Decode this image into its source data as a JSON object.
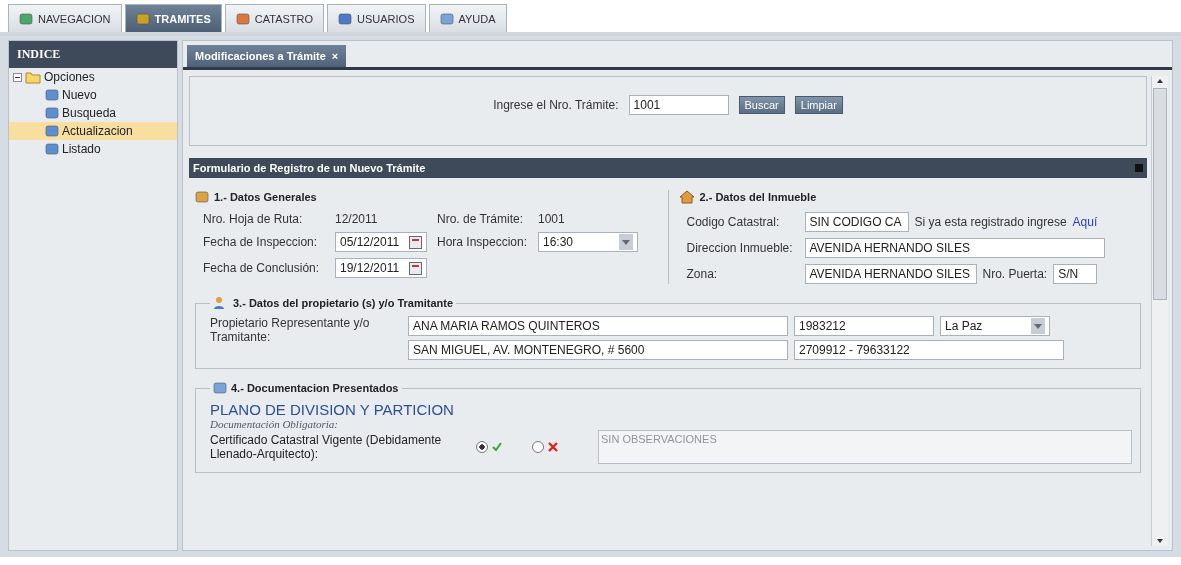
{
  "top_tabs": [
    {
      "label": "NAVEGACION",
      "selected": false
    },
    {
      "label": "TRAMITES",
      "selected": true
    },
    {
      "label": "CATASTRO",
      "selected": false
    },
    {
      "label": "USUARIOS",
      "selected": false
    },
    {
      "label": "AYUDA",
      "selected": false
    }
  ],
  "sidebar": {
    "title": "INDICE",
    "tree": [
      {
        "label": "Opciones",
        "expanded": true,
        "children": [
          {
            "label": "Nuevo",
            "selected": false
          },
          {
            "label": "Busqueda",
            "selected": false
          },
          {
            "label": "Actualizacion",
            "selected": true
          },
          {
            "label": "Listado",
            "selected": false
          }
        ]
      }
    ]
  },
  "doc_tab": {
    "label": "Modificaciones a Trámite",
    "close": "×"
  },
  "search": {
    "label": "Ingrese el Nro. Trámite:",
    "value": "1001",
    "buttons": [
      "Buscar",
      "Limpiar"
    ]
  },
  "form_title": "Formulario de Registro de un Nuevo Trámite",
  "general": {
    "title": "1.- Datos Generales",
    "rows": [
      [
        {
          "kind": "static",
          "label": "Nro. Hoja de Ruta:",
          "value": "12/2011"
        },
        {
          "kind": "static",
          "label": "Nro. de Trámite:",
          "value": "1001"
        }
      ],
      [
        {
          "kind": "date",
          "label": "Fecha de Inspeccion:",
          "value": "05/12/2011"
        },
        {
          "kind": "combo",
          "label": "Hora Inspeccion:",
          "value": "16:30"
        }
      ],
      [
        {
          "kind": "date",
          "label": "Fecha de Conclusión:",
          "value": "19/12/2011"
        }
      ]
    ]
  },
  "inmueble": {
    "title": "2.- Datos del Inmueble",
    "rows": [
      {
        "label": "Codigo Catastral:",
        "value": "SIN CODIGO CA",
        "note": "Si ya esta registrado ingrese",
        "link": "Aquí"
      },
      {
        "label": "Direccion Inmueble:",
        "value": "AVENIDA HERNANDO SILES"
      },
      {
        "label": "Zona:",
        "value": "AVENIDA HERNANDO SILES",
        "extra_label": "Nro. Puerta:",
        "extra_value": "S/N"
      }
    ]
  },
  "propietario": {
    "title": "3.- Datos del propietario (s) y/o Tramitante",
    "label": "Propietario Representante y/o Tramitante:",
    "rows": [
      [
        {
          "kind": "text",
          "value": "ANA MARIA RAMOS QUINTEROS"
        },
        {
          "kind": "text",
          "value": "1983212"
        },
        {
          "kind": "combo",
          "value": "La Paz"
        }
      ],
      [
        {
          "kind": "text",
          "value": "SAN MIGUEL, AV. MONTENEGRO, # 5600"
        },
        {
          "kind": "text",
          "value": "2709912 - 79633122"
        }
      ]
    ]
  },
  "documentos": {
    "title": "4.- Documentacion Presentados",
    "heading": "PLANO DE DIVISION Y PARTICION",
    "subheading": "Documentación Obligatoria:",
    "items": [
      {
        "label": "Certificado Catastral Vigente (Debidamente Llenado-Arquitecto):",
        "accepted": true,
        "placeholder": "SIN OBSERVACIONES"
      }
    ]
  }
}
